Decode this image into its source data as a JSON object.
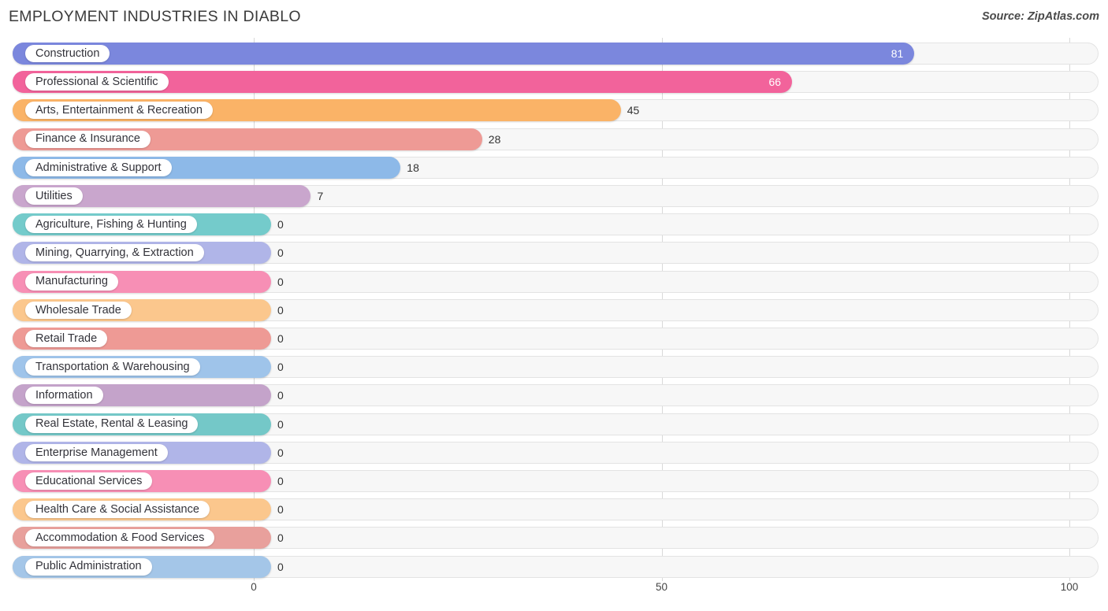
{
  "header": {
    "title": "EMPLOYMENT INDUSTRIES IN DIABLO",
    "source": "Source: ZipAtlas.com"
  },
  "axis": {
    "ticks": [
      "0",
      "50",
      "100"
    ],
    "tick_values": [
      0,
      50,
      100
    ]
  },
  "chart_data": {
    "type": "bar",
    "orientation": "horizontal",
    "title": "EMPLOYMENT INDUSTRIES IN DIABLO",
    "subtitle": "Source: ZipAtlas.com",
    "xlabel": "",
    "ylabel": "",
    "xlim": [
      0,
      100
    ],
    "grid": true,
    "legend": false,
    "categories": [
      "Construction",
      "Professional & Scientific",
      "Arts, Entertainment & Recreation",
      "Finance & Insurance",
      "Administrative & Support",
      "Utilities",
      "Agriculture, Fishing & Hunting",
      "Mining, Quarrying, & Extraction",
      "Manufacturing",
      "Wholesale Trade",
      "Retail Trade",
      "Transportation & Warehousing",
      "Information",
      "Real Estate, Rental & Leasing",
      "Enterprise Management",
      "Educational Services",
      "Health Care & Social Assistance",
      "Accommodation & Food Services",
      "Public Administration"
    ],
    "values": [
      81,
      66,
      45,
      28,
      18,
      7,
      0,
      0,
      0,
      0,
      0,
      0,
      0,
      0,
      0,
      0,
      0,
      0,
      0
    ],
    "value_labels": [
      "81",
      "66",
      "45",
      "28",
      "18",
      "7",
      "0",
      "0",
      "0",
      "0",
      "0",
      "0",
      "0",
      "0",
      "0",
      "0",
      "0",
      "0",
      "0"
    ],
    "colors": [
      "#7b87dd",
      "#f2639b",
      "#fab367",
      "#ee9a95",
      "#8db9e8",
      "#c9a6cd",
      "#74cbcb",
      "#b0b5e8",
      "#f78fb5",
      "#fbc78d",
      "#ee9a95",
      "#9fc4ea",
      "#c4a3ca",
      "#74c8c8",
      "#b0b5e8",
      "#f78fb5",
      "#fbc78d",
      "#e8a09c",
      "#a4c6e8"
    ]
  }
}
